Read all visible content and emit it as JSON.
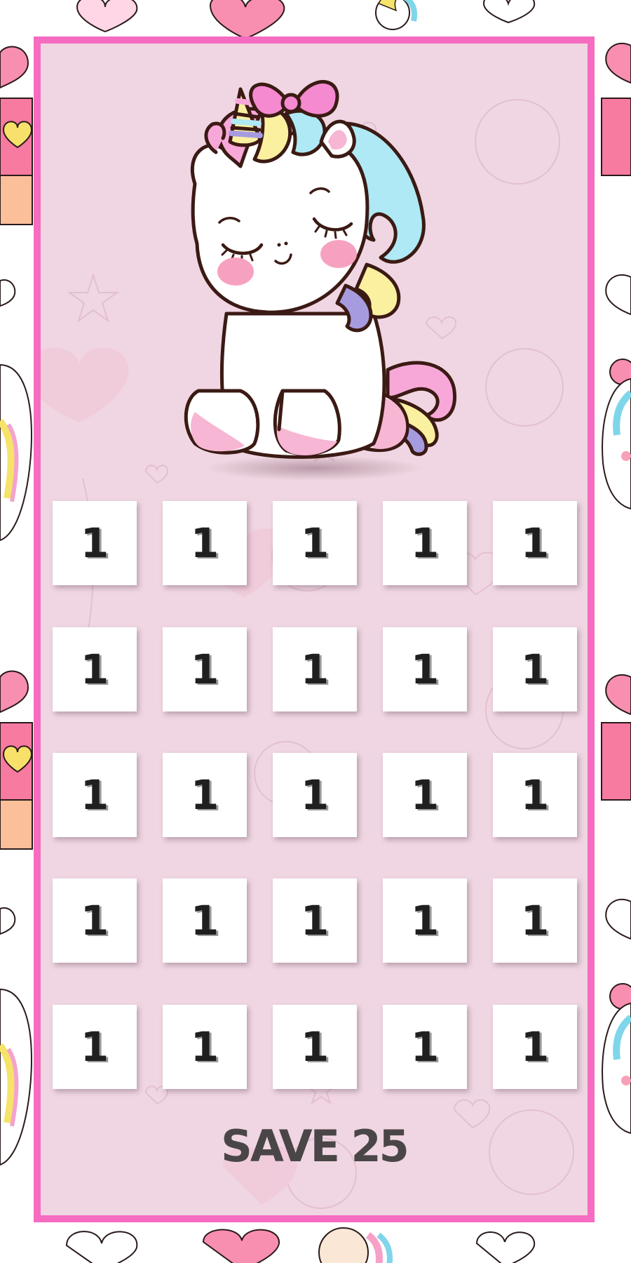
{
  "title": "SAVE 25",
  "grid": {
    "rows": 5,
    "columns": 5,
    "cells": [
      "1",
      "1",
      "1",
      "1",
      "1",
      "1",
      "1",
      "1",
      "1",
      "1",
      "1",
      "1",
      "1",
      "1",
      "1",
      "1",
      "1",
      "1",
      "1",
      "1",
      "1",
      "1",
      "1",
      "1",
      "1"
    ]
  },
  "colors": {
    "frame": "#f56cc0",
    "panel": "#f0d6e2",
    "cell": "#ffffff",
    "number": "#1f1f1f",
    "title": "#4a4648",
    "unicorn_body": "#ffffff",
    "unicorn_outline": "#3b1a14",
    "mane_pink": "#f7a8d8",
    "mane_blue": "#aee9f5",
    "mane_yellow": "#faf0a0",
    "mane_purple": "#a79be0",
    "bow": "#f58ad0"
  },
  "decor": {
    "illustration": "cartoon-unicorn",
    "background_motifs": [
      "heart-icon",
      "balloon-icon",
      "gift-box-icon",
      "star-icon",
      "unicorn-head-icon"
    ]
  }
}
